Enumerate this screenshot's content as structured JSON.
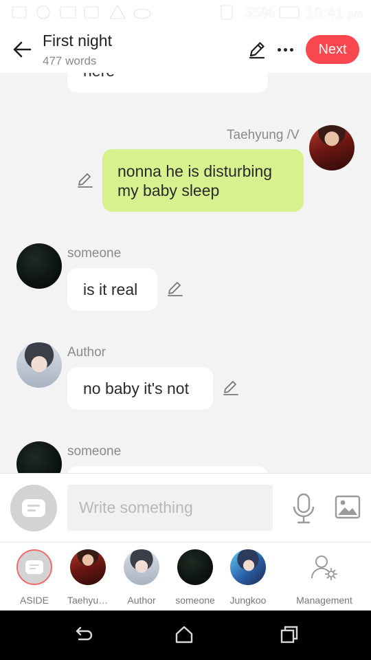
{
  "status_bar": {
    "battery_percent": "35%",
    "time": "10:41",
    "ampm": "pm"
  },
  "header": {
    "title": "First night",
    "word_count": "477 words",
    "next_label": "Next"
  },
  "messages": [
    {
      "id": "partial-top",
      "text": "here"
    },
    {
      "id": "tae-msg",
      "sender": "Taehyung /V",
      "text": "nonna he is disturbing my baby sleep"
    },
    {
      "id": "someone-msg",
      "sender": "someone",
      "text": "is it real"
    },
    {
      "id": "author-msg",
      "sender": "Author",
      "text": "no baby it's not"
    },
    {
      "id": "someone-msg-2",
      "sender": "someone",
      "text": ""
    }
  ],
  "composer": {
    "placeholder": "Write something"
  },
  "roles": [
    {
      "label": "ASIDE",
      "icon": "message-icon"
    },
    {
      "label": "Taehyung /V"
    },
    {
      "label": "Author"
    },
    {
      "label": "someone"
    },
    {
      "label": "Jungkoo"
    },
    {
      "label": "Management",
      "icon": "user-settings-icon"
    }
  ],
  "colors": {
    "accent": "#f8474f",
    "outgoing_bubble": "#d6f18e",
    "incoming_bubble": "#ffffff",
    "chat_background": "#f3f3f3"
  }
}
